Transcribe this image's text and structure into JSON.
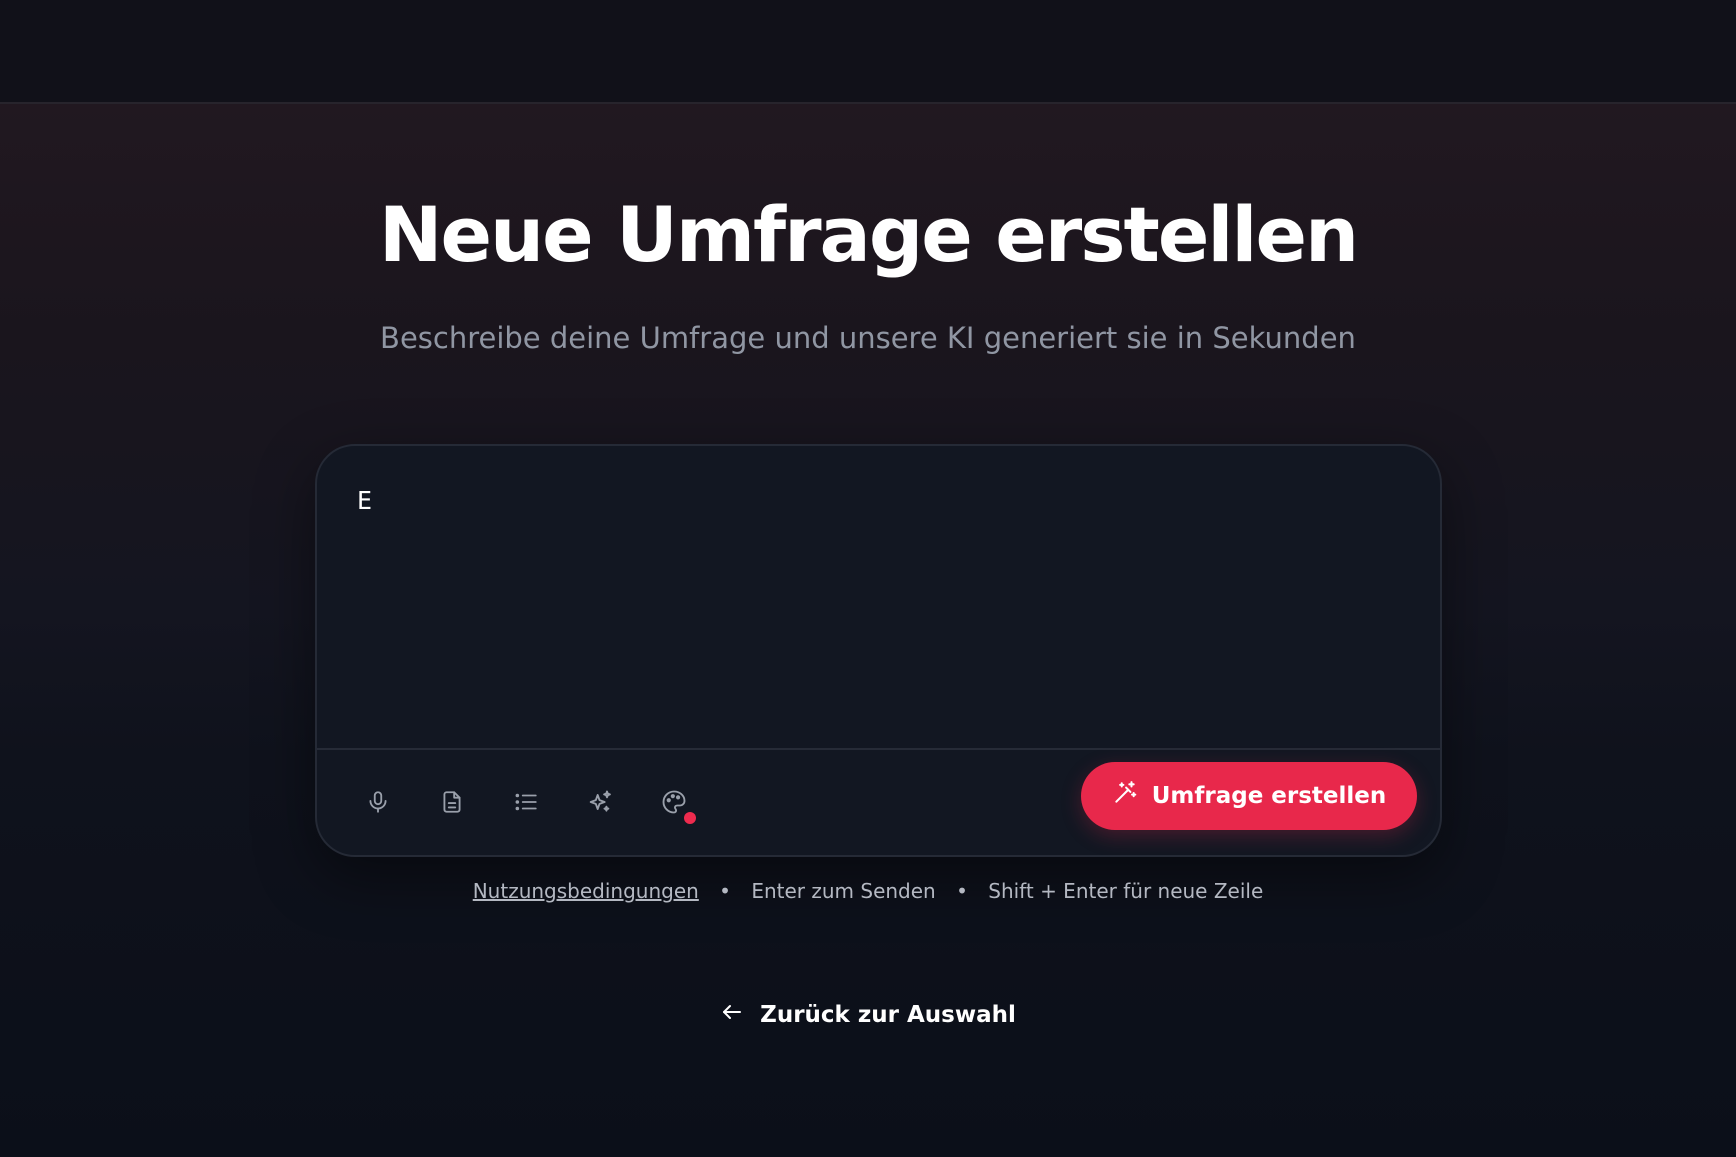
{
  "header": {},
  "hero": {
    "title": "Neue Umfrage erstellen",
    "subtitle": "Beschreibe deine Umfrage und unsere KI generiert sie in Sekunden"
  },
  "composer": {
    "input_value": "E",
    "toolbar_icons": [
      "microphone-icon",
      "document-icon",
      "list-icon",
      "sparkles-icon",
      "palette-icon"
    ],
    "palette_badge_color": "#ee2b4e",
    "submit_label": "Umfrage erstellen",
    "submit_icon": "magic-wand-icon",
    "accent_color": "#e8284b"
  },
  "hints": {
    "terms_link": "Nutzungsbedingungen",
    "separator": "•",
    "enter_hint": "Enter zum Senden",
    "shift_enter_hint": "Shift + Enter für neue Zeile"
  },
  "back": {
    "label": "Zurück zur Auswahl",
    "icon": "arrow-left-icon"
  }
}
